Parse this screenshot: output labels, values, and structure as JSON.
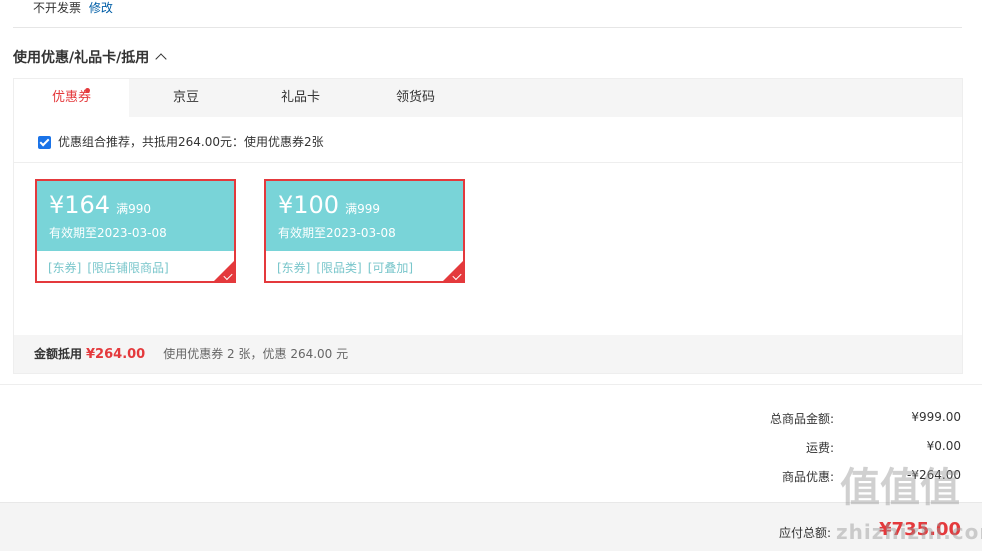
{
  "invoice": {
    "text": "不开发票",
    "edit_label": "修改"
  },
  "section_title": "使用优惠/礼品卡/抵用",
  "tabs": [
    {
      "label": "优惠券",
      "active": true,
      "has_dot": true
    },
    {
      "label": "京豆",
      "active": false
    },
    {
      "label": "礼品卡",
      "active": false
    },
    {
      "label": "领货码",
      "active": false
    }
  ],
  "combo": {
    "checked": true,
    "text": "优惠组合推荐，共抵用264.00元：使用优惠券2张"
  },
  "coupons": [
    {
      "amount": "¥164",
      "condition": "满990",
      "validity": "有效期至2023-03-08",
      "tags": [
        "[东券]",
        "[限店铺限商品]"
      ],
      "selected": true
    },
    {
      "amount": "¥100",
      "condition": "满999",
      "validity": "有效期至2023-03-08",
      "tags": [
        "[东券]",
        "[限品类]",
        "[可叠加]"
      ],
      "selected": true
    }
  ],
  "summary": {
    "label": "金额抵用",
    "amount": "¥264.00",
    "desc": "使用优惠券 2 张，优惠 264.00 元"
  },
  "totals": [
    {
      "label": "总商品金额:",
      "value": "¥999.00"
    },
    {
      "label": "运费:",
      "value": "¥0.00"
    },
    {
      "label": "商品优惠:",
      "value": "-¥264.00"
    }
  ],
  "payable": {
    "label": "应付总额:",
    "value": "¥735.00"
  },
  "watermark": {
    "glyphs": "值值值",
    "text": "zhizhizhi.com"
  },
  "colors": {
    "accent_red": "#e4393c",
    "coupon_teal": "#79d4d8",
    "link_blue": "#005ea7",
    "checkbox_blue": "#1a73e8"
  }
}
